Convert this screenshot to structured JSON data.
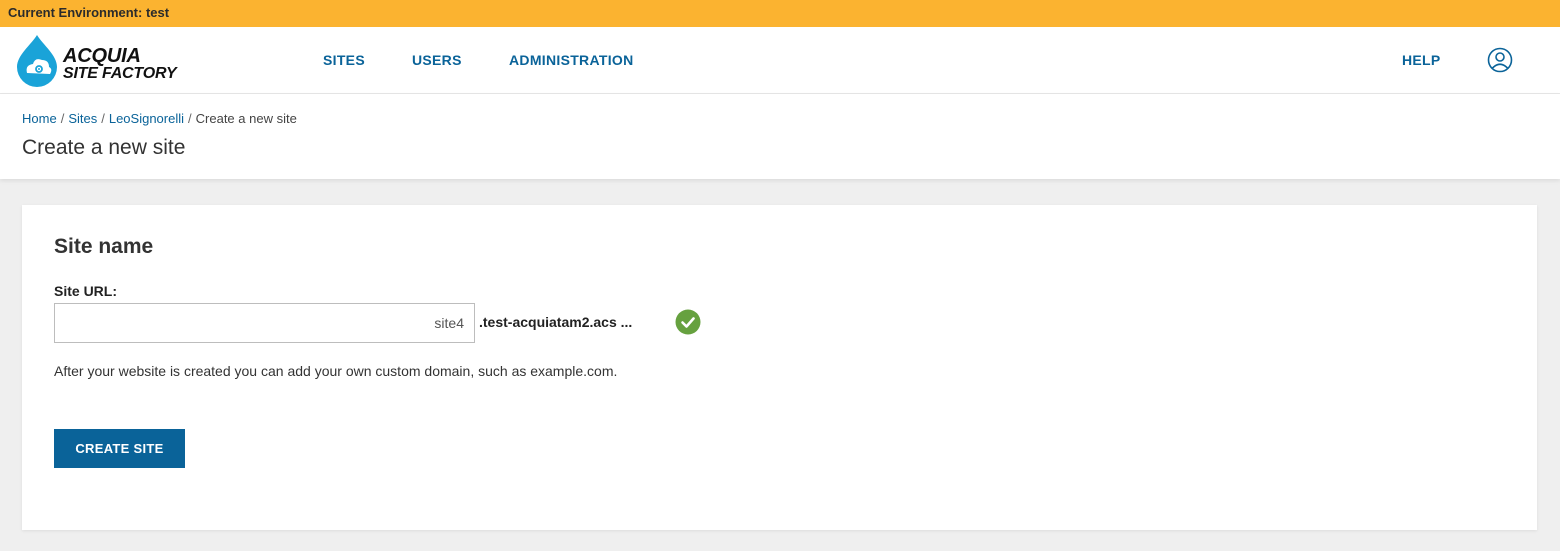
{
  "environment_bar": {
    "text": "Current Environment: test",
    "color": "#fbb330"
  },
  "brand": {
    "line1": "ACQUIA",
    "line2": "SITE FACTORY",
    "logo_color": "#1aa3d8"
  },
  "nav": {
    "items": [
      {
        "label": "SITES"
      },
      {
        "label": "USERS"
      },
      {
        "label": "ADMINISTRATION"
      }
    ],
    "help": "HELP",
    "user_icon": "user-circle-icon"
  },
  "breadcrumb": {
    "items": [
      "Home",
      "Sites",
      "LeoSignorelli"
    ],
    "current": "Create a new site",
    "separator": "/"
  },
  "page_title": "Create a new site",
  "form": {
    "section_title": "Site name",
    "site_url_label": "Site URL:",
    "site_url_value": "site4",
    "domain_suffix": ".test-acquiatam2.acs ...",
    "valid_icon": "check-circle-icon",
    "valid_color": "#66a13f",
    "help_text": "After your website is created you can add your own custom domain, such as example.com.",
    "submit_label": "CREATE SITE"
  },
  "colors": {
    "accent": "#0a6399"
  }
}
